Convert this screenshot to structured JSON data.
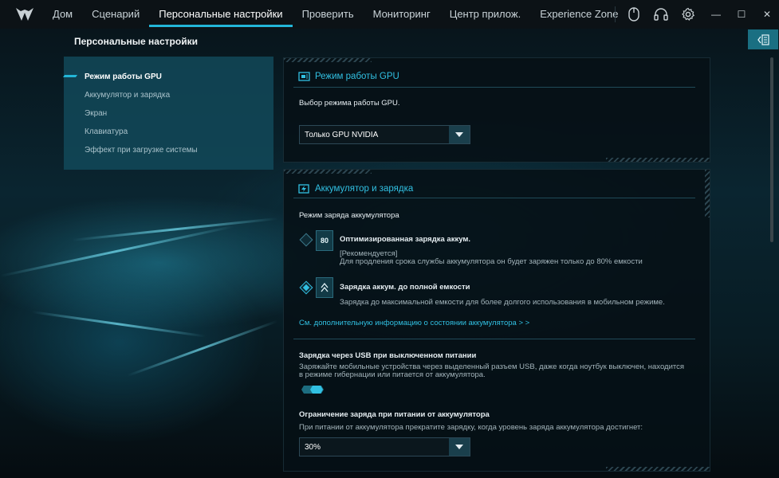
{
  "nav": {
    "items": [
      {
        "label": "Дом",
        "active": false
      },
      {
        "label": "Сценарий",
        "active": false
      },
      {
        "label": "Персональные настройки",
        "active": true
      },
      {
        "label": "Проверить",
        "active": false
      },
      {
        "label": "Мониторинг",
        "active": false
      },
      {
        "label": "Центр прилож.",
        "active": false
      },
      {
        "label": "Experience Zone",
        "active": false
      }
    ],
    "icons": [
      "mouse-icon",
      "headset-icon",
      "gear-icon"
    ],
    "window_buttons": {
      "minimize": "—",
      "maximize": "☐",
      "close": "✕"
    }
  },
  "page": {
    "title": "Персональные настройки"
  },
  "sidebar": {
    "items": [
      {
        "label": "Режим работы GPU",
        "active": true
      },
      {
        "label": "Аккумулятор и зарядка",
        "active": false
      },
      {
        "label": "Экран",
        "active": false
      },
      {
        "label": "Клавиатура",
        "active": false
      },
      {
        "label": "Эффект при загрузке системы",
        "active": false
      }
    ]
  },
  "gpu": {
    "title": "Режим работы GPU",
    "desc": "Выбор режима работы GPU.",
    "selected": "Только GPU NVIDIA"
  },
  "battery": {
    "title": "Аккумулятор и зарядка",
    "mode_label": "Режим заряда аккумулятора",
    "opt1": {
      "title": "Оптимизированная зарядка аккум.",
      "icon_text": "80",
      "recommended": "[Рекомендуется]",
      "desc": "Для продления срока службы аккумулятора он будет заряжен только до 80% емкости",
      "selected": false
    },
    "opt2": {
      "title": "Зарядка аккум. до полной емкости",
      "desc": "Зарядка до максимальной емкости для более долгого использования в мобильном режиме.",
      "selected": true
    },
    "more_link": "См. дополнительную информацию о состоянии аккумулятора >  >",
    "usb": {
      "title": "Зарядка через USB при выключенном питании",
      "desc1": "Заряжайте мобильные устройства через выделенный разъем USB, даже когда ноутбук выключен, находится",
      "desc2": "в режиме гибернации или питается от аккумулятора.",
      "enabled": true
    },
    "limit": {
      "title": "Ограничение заряда при питании от аккумулятора",
      "desc": "При питании от аккумулятора прекратите зарядку, когда уровень заряда аккумулятора достигнет:",
      "selected": "30%"
    }
  },
  "colors": {
    "accent": "#23b6d8",
    "sidebar_bg": "#124a5c",
    "card_bg": "#061016"
  }
}
